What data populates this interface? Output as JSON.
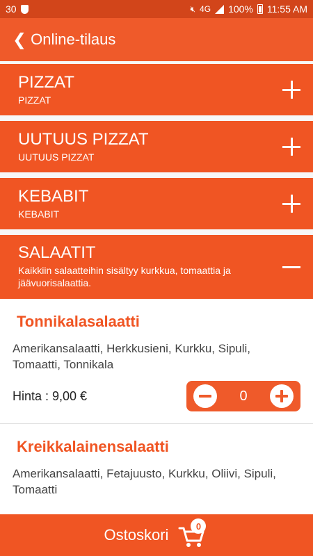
{
  "status_bar": {
    "notification_count": "30",
    "network": "4G",
    "battery": "100%",
    "time": "11:55 AM"
  },
  "app_bar": {
    "title": "Online-tilaus"
  },
  "categories": [
    {
      "title": "PIZZAT",
      "subtitle": "PIZZAT",
      "expanded": false
    },
    {
      "title": "UUTUUS PIZZAT",
      "subtitle": "UUTUUS PIZZAT",
      "expanded": false
    },
    {
      "title": "KEBABIT",
      "subtitle": "KEBABIT",
      "expanded": false
    },
    {
      "title": "SALAATIT",
      "subtitle": "Kaikkiin salaatteihin sisältyy kurkkua, tomaattia ja jäävuorisalaattia.",
      "expanded": true
    }
  ],
  "products": [
    {
      "name": "Tonnikalasalaatti",
      "description": "Amerikansalaatti, Herkkusieni, Kurkku, Sipuli, Tomaatti, Tonnikala",
      "price": "Hinta : 9,00 €",
      "quantity": "0"
    },
    {
      "name": "Kreikkalainensalaatti",
      "description": "Amerikansalaatti, Fetajuusto, Kurkku, Oliivi, Sipuli, Tomaatti"
    }
  ],
  "cart": {
    "label": "Ostoskori",
    "count": "0"
  },
  "colors": {
    "accent": "#f05523",
    "status_bar": "#d2451a"
  },
  "icons": {
    "back": "chevron-left-icon",
    "expand": "plus-icon",
    "collapse": "minus-icon",
    "cart": "shopping-cart-icon"
  }
}
